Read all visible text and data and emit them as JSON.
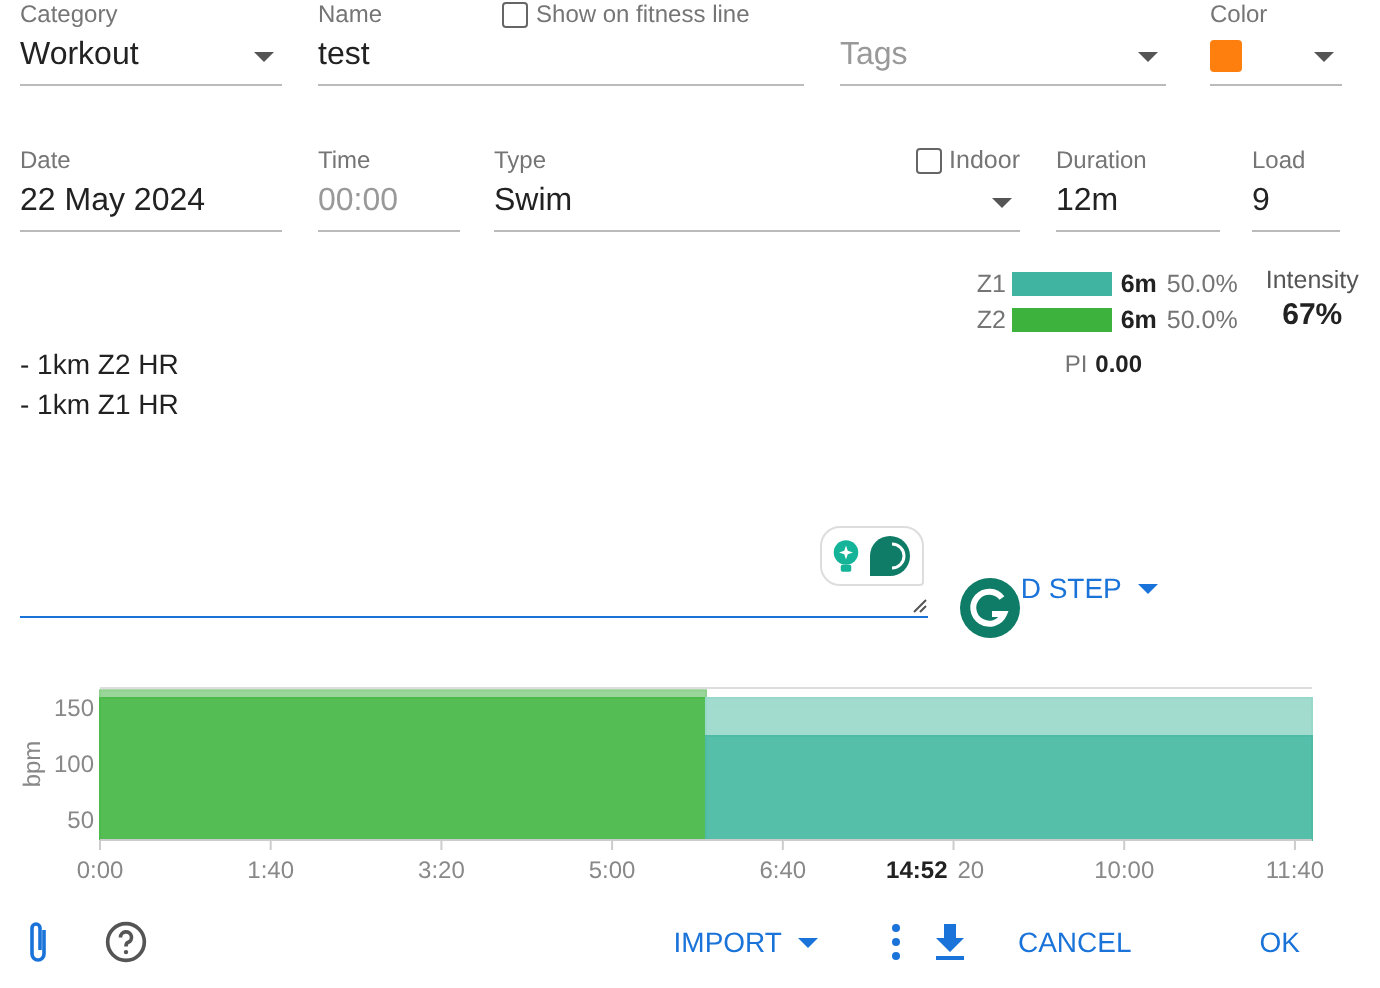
{
  "category": {
    "label": "Category",
    "value": "Workout"
  },
  "name": {
    "label": "Name",
    "value": "test"
  },
  "fitness_line": {
    "label": "Show on fitness line",
    "checked": false
  },
  "tags": {
    "placeholder": "Tags"
  },
  "color": {
    "label": "Color",
    "color": "#ff7f0e"
  },
  "date": {
    "label": "Date",
    "value": "22 May 2024"
  },
  "time": {
    "label": "Time",
    "placeholder": "00:00"
  },
  "type": {
    "label": "Type",
    "value": "Swim"
  },
  "indoor": {
    "label": "Indoor",
    "checked": false
  },
  "duration": {
    "label": "Duration",
    "value": "12m"
  },
  "load": {
    "label": "Load",
    "value": "9"
  },
  "description": {
    "value": "- 1km Z2 HR\n- 1km Z1 HR"
  },
  "zones": [
    {
      "name": "Z1",
      "color": "#40b4a0",
      "time": "6m",
      "percent": "50.0%"
    },
    {
      "name": "Z2",
      "color": "#3db33d",
      "time": "6m",
      "percent": "50.0%"
    }
  ],
  "intensity": {
    "label": "Intensity",
    "value": "67%"
  },
  "pi": {
    "label": "PI",
    "value": "0.00"
  },
  "add_step": {
    "label": "D STEP"
  },
  "chart": {
    "hover_label": "14:52",
    "partial_tick_label": "20",
    "chart_data": {
      "type": "area",
      "ylabel": "bpm",
      "x": [
        0,
        355,
        355,
        710
      ],
      "xlim": [
        0,
        710
      ],
      "ylim": [
        30,
        166
      ],
      "series": [
        {
          "color": "#8fd08f",
          "values": [
            164,
            164,
            null,
            null
          ]
        },
        {
          "color": "#4cbb4c",
          "values": [
            157,
            157,
            null,
            null
          ]
        },
        {
          "color": "#97d8ca",
          "values": [
            null,
            null,
            157,
            157
          ]
        },
        {
          "color": "#4dbba5",
          "values": [
            null,
            null,
            123,
            123
          ]
        }
      ],
      "xticks": [
        {
          "value": 0,
          "label": "0:00"
        },
        {
          "value": 100,
          "label": "1:40"
        },
        {
          "value": 200,
          "label": "3:20"
        },
        {
          "value": 300,
          "label": "5:00"
        },
        {
          "value": 400,
          "label": "6:40"
        },
        {
          "value": 600,
          "label": "10:00"
        },
        {
          "value": 700,
          "label": "11:40"
        }
      ],
      "yticks": [
        50,
        100,
        150
      ]
    }
  },
  "footer": {
    "import": "IMPORT",
    "cancel": "CANCEL",
    "ok": "OK"
  }
}
